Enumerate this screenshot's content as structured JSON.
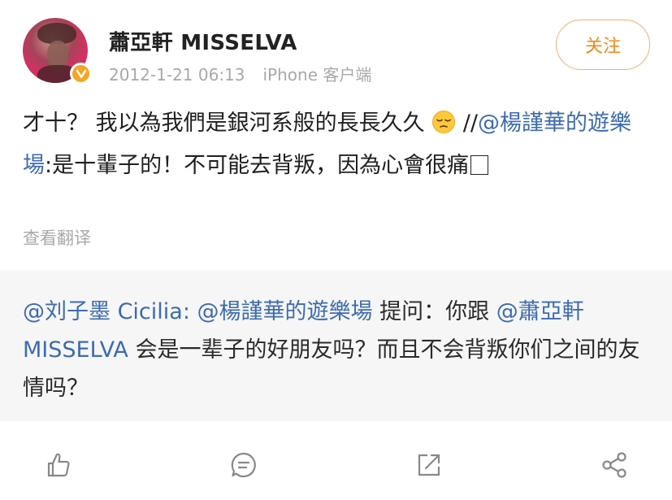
{
  "user": {
    "name": "蕭亞軒 MISSELVA",
    "date": "2012-1-21 06:13",
    "source": "iPhone 客户端",
    "badge": "v"
  },
  "follow_label": "关注",
  "post": {
    "text_a": "才十？ 我以為我們是銀河系般的長長久久 ",
    "emoji": "pensive-face-emoji",
    "slashes": " //",
    "mention": "@楊謹華的遊樂場",
    "text_b": ":是十輩子的！不可能去背叛，因為心會很痛"
  },
  "translate_label": "查看翻译",
  "quote": {
    "author": "@刘子墨 Cicilia:",
    "mention_1": "@楊謹華的遊樂場",
    "text_1": " 提问：你跟 ",
    "mention_2": "@蕭亞軒MISSELVA",
    "text_2": " 会是一辈子的好朋友吗？而且不会背叛你们之间的友情吗？"
  },
  "actions": [
    "like-icon",
    "comment-icon",
    "repost-icon",
    "share-icon"
  ],
  "colors": {
    "accent": "#ee8a1f",
    "link": "#3d6bb0",
    "badge": "#f5a623"
  }
}
